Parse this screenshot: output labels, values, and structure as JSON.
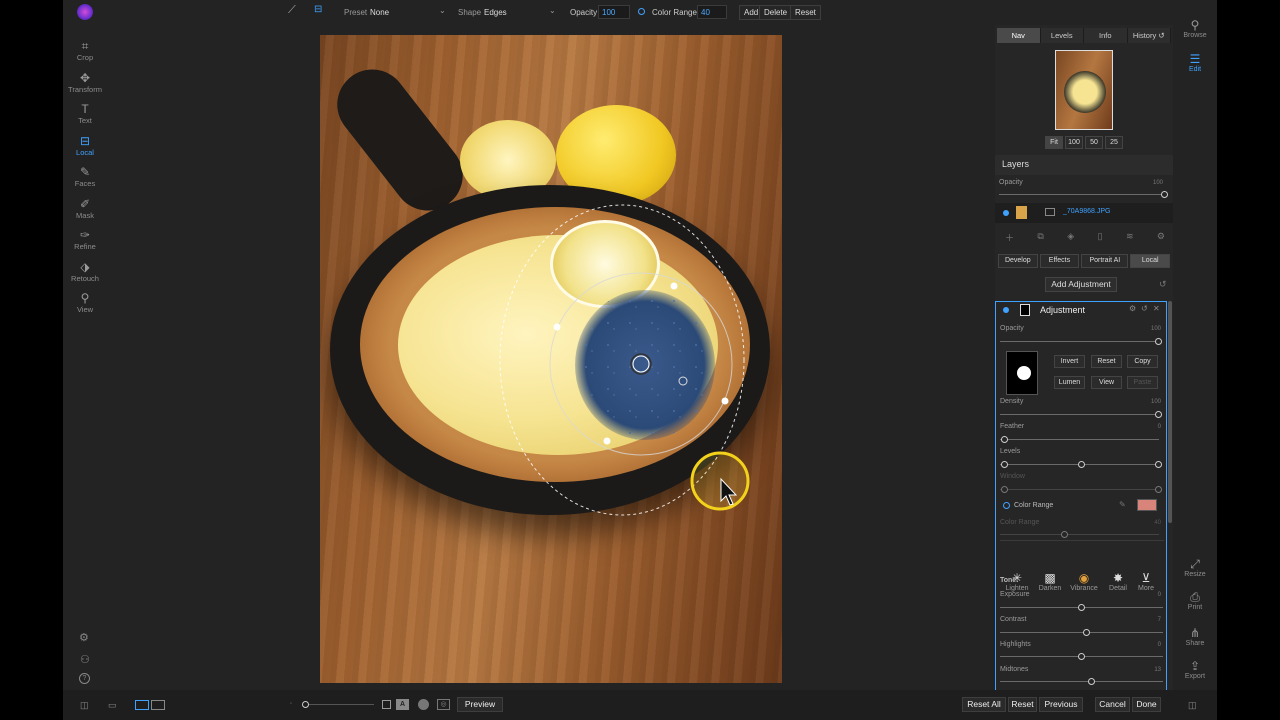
{
  "toolbar": {
    "preset_label": "Preset",
    "preset_value": "None",
    "shape_label": "Shape",
    "shape_value": "Edges",
    "opacity_label": "Opacity",
    "opacity_value": "100",
    "color_range_label": "Color Range",
    "color_range_value": "40",
    "add_label": "Add",
    "delete_label": "Delete",
    "reset_label": "Reset"
  },
  "left_tools": [
    {
      "label": "Crop",
      "icon": "crop-icon"
    },
    {
      "label": "Transform",
      "icon": "move-icon"
    },
    {
      "label": "Text",
      "icon": "text-icon"
    },
    {
      "label": "Local",
      "icon": "local-icon"
    },
    {
      "label": "Faces",
      "icon": "faces-icon"
    },
    {
      "label": "Mask",
      "icon": "mask-icon"
    },
    {
      "label": "Refine",
      "icon": "refine-icon"
    },
    {
      "label": "Retouch",
      "icon": "retouch-icon"
    },
    {
      "label": "View",
      "icon": "view-icon"
    }
  ],
  "right_tools": {
    "browse": "Browse",
    "edit": "Edit",
    "resize": "Resize",
    "print": "Print",
    "share": "Share",
    "export": "Export"
  },
  "panel": {
    "tabs": [
      "Nav",
      "Levels",
      "Info",
      "History"
    ],
    "zoom_options": [
      "Fit",
      "100",
      "50",
      "25"
    ],
    "layers_title": "Layers",
    "layers_opacity_label": "Opacity",
    "layers_opacity_value": "100",
    "layer_name": "_70A9868.JPG",
    "module_tabs": [
      "Develop",
      "Effects",
      "Portrait AI",
      "Local"
    ],
    "add_adjustment": "Add Adjustment",
    "adjustment_title": "Adjustment",
    "opacity_label": "Opacity",
    "opacity_value": "100",
    "mask_buttons": [
      "Invert",
      "Reset",
      "Copy",
      "Lumen",
      "View",
      "Paste"
    ],
    "density_label": "Density",
    "density_value": "100",
    "feather_label": "Feather",
    "feather_value": "0",
    "levels_label": "Levels",
    "window_label": "Window",
    "color_range_label": "Color Range",
    "color_range_slider_label": "Color Range",
    "color_range_slider_value": "40",
    "color_swatch": "#d8847a",
    "effects": [
      "Lighten",
      "Darken",
      "Vibrance",
      "Detail",
      "More"
    ],
    "tone_label": "Tone:",
    "exposure_label": "Exposure",
    "exposure_value": "0",
    "contrast_label": "Contrast",
    "contrast_value": "7",
    "highlights_label": "Highlights",
    "highlights_value": "0",
    "midtones_label": "Midtones",
    "midtones_value": "13"
  },
  "bottom": {
    "preview_label": "Preview",
    "reset_all": "Reset All",
    "reset": "Reset",
    "previous": "Previous",
    "cancel": "Cancel",
    "done": "Done"
  },
  "colors": {
    "accent": "#3fa2ff",
    "background": "#232323"
  }
}
